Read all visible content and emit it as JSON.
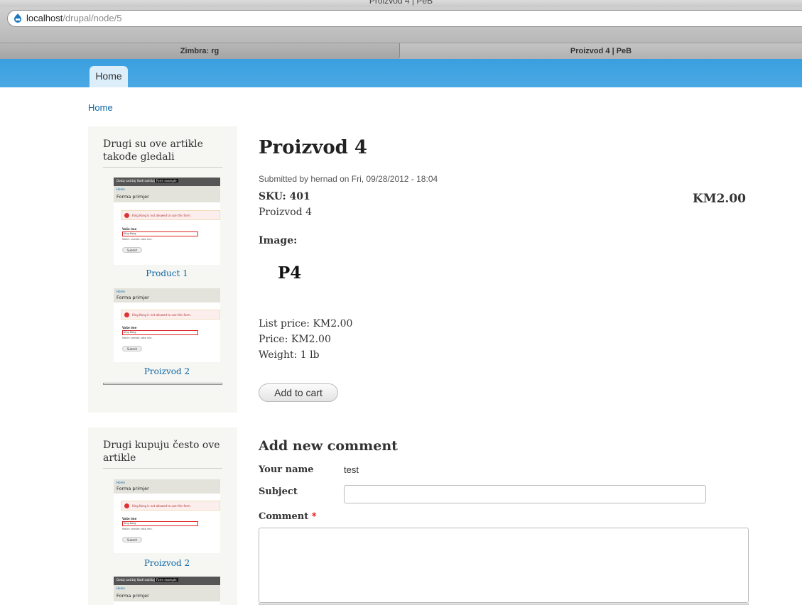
{
  "browser": {
    "window_title": "Proizvod 4 | PeB",
    "url_host": "localhost",
    "url_path": "/drupal/node/5",
    "tabs": [
      {
        "label": "Zimbra: rg"
      },
      {
        "label": "Proizvod 4 | PeB"
      }
    ]
  },
  "site": {
    "nav_home": "Home",
    "breadcrumb": "Home"
  },
  "sidebar": {
    "block1": {
      "title": "Drugi su ove artikle takođe gledali",
      "items": [
        {
          "caption": "Product 1"
        },
        {
          "caption": "Proizvod 2"
        }
      ]
    },
    "block2": {
      "title": "Drugi kupuju često ove artikle",
      "items": [
        {
          "caption": "Proizvod 2"
        }
      ]
    },
    "thumb": {
      "tab1": "Dodaj sadržaj",
      "tab2": "Nađi sadržaj",
      "tab3": "Form example",
      "home": "Home",
      "form_title": "Forma primjer",
      "error": "King Kong is not allowed to use this form.",
      "label": "Vaše ime",
      "value": "King Kong",
      "hint": "Molim unesite vaše ime.",
      "button": "Submit"
    }
  },
  "product": {
    "title": "Proizvod 4",
    "submitted": "Submitted by hernad on Fri, 09/28/2012 - 18:04",
    "sku": "SKU: 401",
    "sku_name": "Proizvod 4",
    "display_price": "KM2.00",
    "image_label": "Image:",
    "image_alt": "P4",
    "list_price": "List price: KM2.00",
    "price": "Price: KM2.00",
    "weight": "Weight: 1 lb",
    "add_to_cart": "Add to cart"
  },
  "comment_form": {
    "title": "Add new comment",
    "name_label": "Your name",
    "name_value": "test",
    "subject_label": "Subject",
    "subject_value": "",
    "comment_label": "Comment",
    "required_mark": "*"
  }
}
